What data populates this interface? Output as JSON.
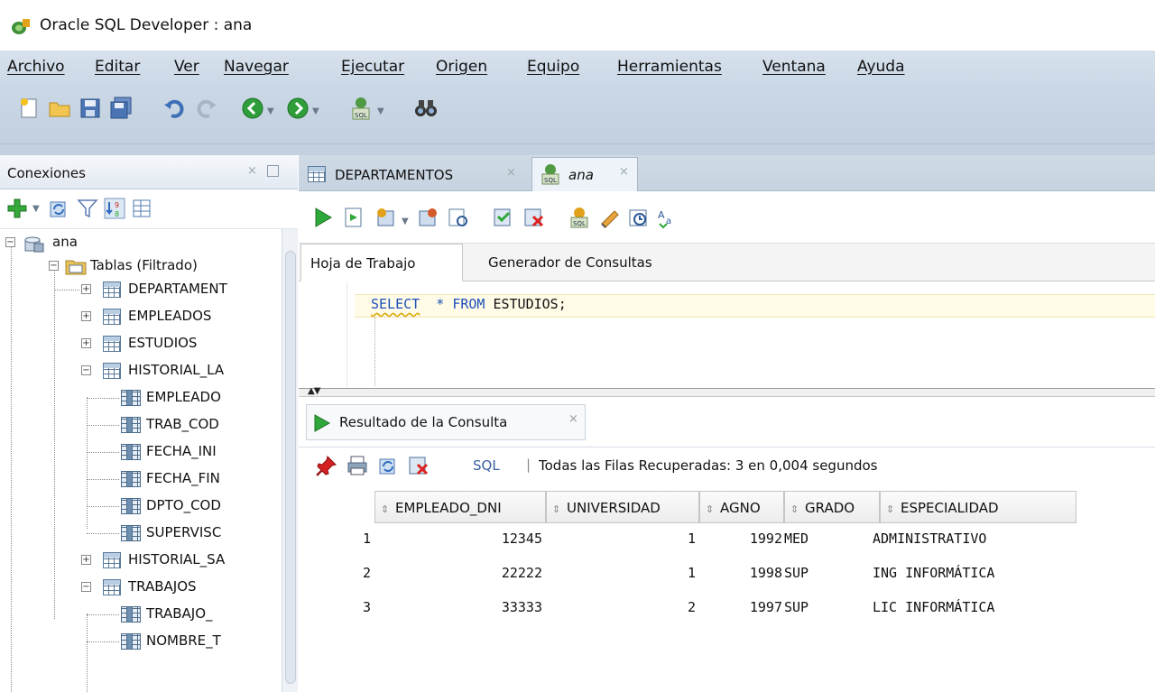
{
  "window": {
    "title": "Oracle SQL Developer : ana"
  },
  "menu": [
    "Archivo",
    "Editar",
    "Ver",
    "Navegar",
    "Ejecutar",
    "Origen",
    "Equipo",
    "Herramientas",
    "Ventana",
    "Ayuda"
  ],
  "connections": {
    "title": "Conexiones",
    "tree": [
      {
        "label": "ana",
        "toggle": "−"
      },
      {
        "label": "Tablas (Filtrado)",
        "toggle": "−"
      },
      {
        "label": "DEPARTAMENT",
        "toggle": "+"
      },
      {
        "label": "EMPLEADOS",
        "toggle": "+"
      },
      {
        "label": "ESTUDIOS",
        "toggle": "+"
      },
      {
        "label": "HISTORIAL_LA",
        "toggle": "−"
      },
      {
        "label": "EMPLEADO"
      },
      {
        "label": "TRAB_COD"
      },
      {
        "label": "FECHA_INI"
      },
      {
        "label": "FECHA_FIN"
      },
      {
        "label": "DPTO_COD"
      },
      {
        "label": "SUPERVISC"
      },
      {
        "label": "HISTORIAL_SA",
        "toggle": "+"
      },
      {
        "label": "TRABAJOS",
        "toggle": "−"
      },
      {
        "label": "TRABAJO_"
      },
      {
        "label": "NOMBRE_T"
      }
    ]
  },
  "doc_tabs": [
    {
      "label": "DEPARTAMENTOS",
      "close": "×"
    },
    {
      "label": "ana",
      "close": "×"
    }
  ],
  "worksheet_tabs": [
    "Hoja de Trabajo",
    "Generador de Consultas"
  ],
  "editor": {
    "kw1": "SELECT",
    "star": "*",
    "kw2": "FROM",
    "table": "ESTUDIOS;"
  },
  "results": {
    "tab_label": "Resultado de la Consulta",
    "tab_close": "×",
    "sql_link": "SQL",
    "separator": "|",
    "status": "Todas las Filas Recuperadas: 3 en 0,004 segundos",
    "columns": [
      "EMPLEADO_DNI",
      "UNIVERSIDAD",
      "AGNO",
      "GRADO",
      "ESPECIALIDAD"
    ],
    "rows": [
      {
        "n": "1",
        "dni": "12345",
        "uni": "1",
        "agno": "1992",
        "grado": "MED",
        "esp": "ADMINISTRATIVO"
      },
      {
        "n": "2",
        "dni": "22222",
        "uni": "1",
        "agno": "1998",
        "grado": "SUP",
        "esp": "ING INFORMÁTICA"
      },
      {
        "n": "3",
        "dni": "33333",
        "uni": "2",
        "agno": "1997",
        "grado": "SUP",
        "esp": "LIC INFORMÁTICA"
      }
    ]
  }
}
